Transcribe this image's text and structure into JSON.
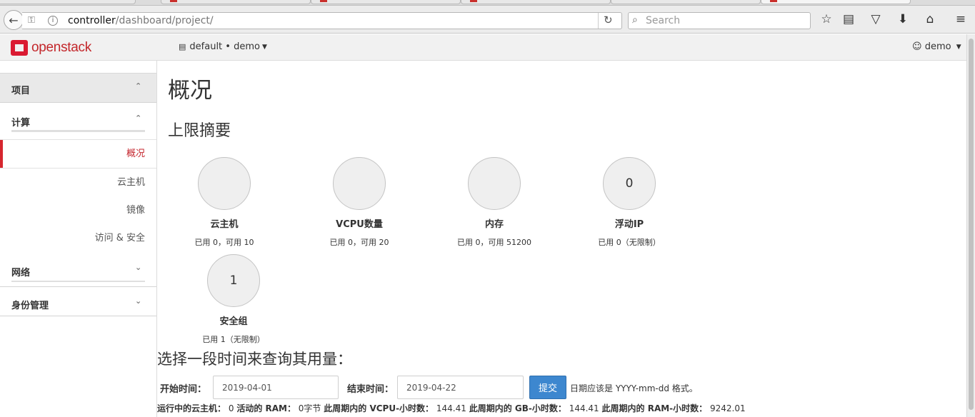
{
  "browser": {
    "url_host": "controller",
    "url_path": "/dashboard/project/",
    "search_placeholder": "Search"
  },
  "header": {
    "logo_text": "openstack",
    "project_selector": "default • demo",
    "user": "demo"
  },
  "sidebar": {
    "section_project": "项目",
    "group_compute": "计算",
    "items": [
      "概况",
      "云主机",
      "镜像",
      "访问 & 安全"
    ],
    "active_item": "概况",
    "group_network": "网络",
    "section_identity": "身份管理"
  },
  "main": {
    "title": "概况",
    "limit_summary_title": "上限摘要",
    "pies": [
      {
        "value": "",
        "name": "云主机",
        "stat": "已用 0，可用 10"
      },
      {
        "value": "",
        "name": "VCPU数量",
        "stat": "已用 0，可用 20"
      },
      {
        "value": "",
        "name": "内存",
        "stat": "已用 0，可用 51200"
      },
      {
        "value": "0",
        "name": "浮动IP",
        "stat": "已用 0（无限制）"
      },
      {
        "value": "1",
        "name": "安全组",
        "stat": "已用 1（无限制）"
      }
    ],
    "usage_title": "选择一段时间来查询其用量：",
    "form": {
      "start_label": "开始时间：",
      "start_value": "2019-04-01",
      "end_label": "结束时间：",
      "end_value": "2019-04-22",
      "submit_label": "提交",
      "hint": "日期应该是 YYYY-mm-dd 格式。"
    },
    "summary": {
      "active_instances_label": "运行中的云主机：",
      "active_instances_value": "0",
      "active_ram_label": "活动的 RAM：",
      "active_ram_value": "0字节",
      "vcpu_hours_label": "此周期内的 VCPU-小时数：",
      "vcpu_hours_value": "144.41",
      "gb_hours_label": "此周期内的 GB-小时数：",
      "gb_hours_value": "144.41",
      "ram_hours_label": "此周期内的 RAM-小时数：",
      "ram_hours_value": "9242.01"
    }
  },
  "colors": {
    "brand_red": "#da1a32",
    "active_red": "#c4262e",
    "button_blue": "#3d87cf"
  }
}
